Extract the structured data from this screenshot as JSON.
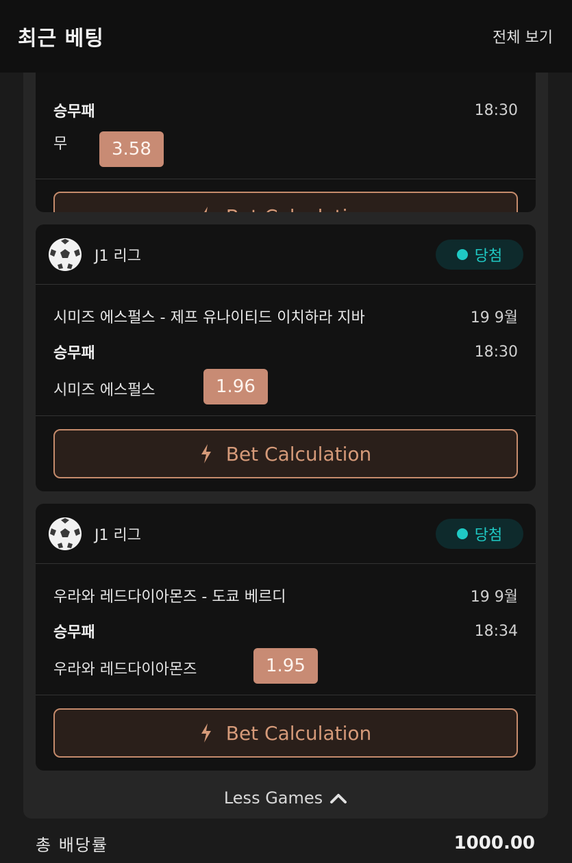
{
  "header": {
    "title": "최근 베팅",
    "view_all": "전체 보기"
  },
  "cards": [
    {
      "market": "승무패",
      "time": "18:30",
      "pick": "무",
      "odds": "3.58",
      "calc_label": "Bet Calculation"
    },
    {
      "league": "J1 리그",
      "status": "당첨",
      "match": "시미즈 에스펄스 - 제프 유나이티드 이치하라 지바",
      "date": "19 9월",
      "market": "승무패",
      "time": "18:30",
      "pick": "시미즈 에스펄스",
      "odds": "1.96",
      "calc_label": "Bet Calculation"
    },
    {
      "league": "J1 리그",
      "status": "당첨",
      "match": "우라와 레드다이아몬즈 - 도쿄 베르디",
      "date": "19 9월",
      "market": "승무패",
      "time": "18:34",
      "pick": "우라와 레드다이아몬즈",
      "odds": "1.95",
      "calc_label": "Bet Calculation"
    }
  ],
  "less_games": "Less Games",
  "footer": {
    "label": "총 배당률",
    "value": "1000.00"
  },
  "colors": {
    "accent": "#c58b6c",
    "odds_bg": "#c88b74",
    "win": "#1fc9c4"
  }
}
